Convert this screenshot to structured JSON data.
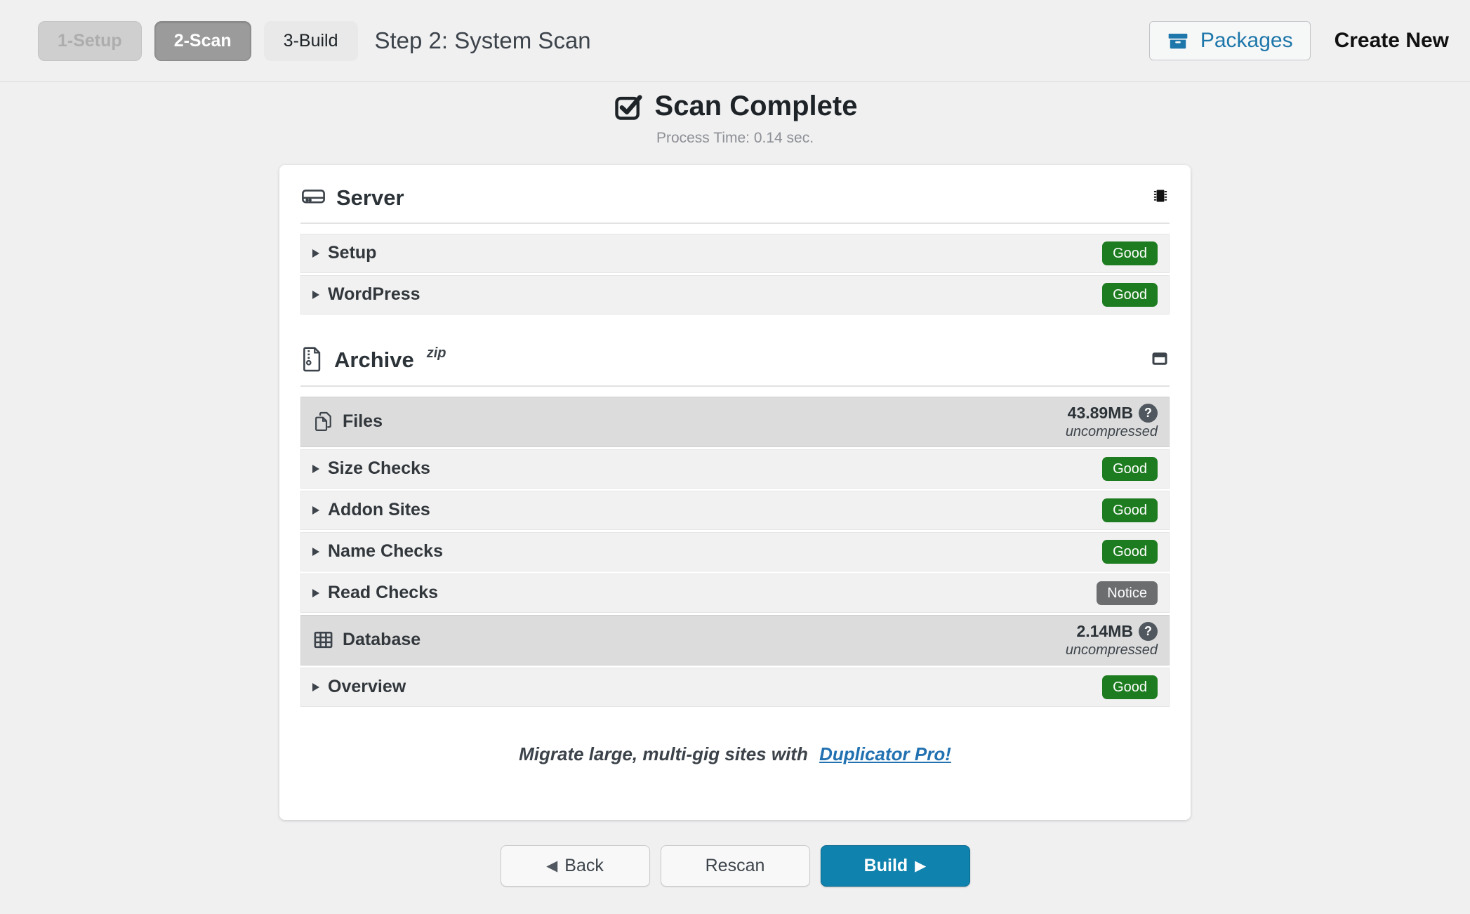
{
  "header": {
    "tabs": [
      {
        "label": "1-Setup",
        "state": "disabled"
      },
      {
        "label": "2-Scan",
        "state": "active"
      },
      {
        "label": "3-Build",
        "state": "upcoming"
      }
    ],
    "title": "Step 2: System Scan",
    "packages_label": "Packages",
    "create_new_label": "Create New"
  },
  "status": {
    "title": "Scan Complete",
    "process_time": "Process Time: 0.14 sec."
  },
  "server_section": {
    "title": "Server",
    "rows": [
      {
        "label": "Setup",
        "status": "Good"
      },
      {
        "label": "WordPress",
        "status": "Good"
      }
    ]
  },
  "archive_section": {
    "title": "Archive",
    "format": "zip",
    "files_group": {
      "label": "Files",
      "size": "43.89MB",
      "note": "uncompressed"
    },
    "files_rows": [
      {
        "label": "Size Checks",
        "status": "Good"
      },
      {
        "label": "Addon Sites",
        "status": "Good"
      },
      {
        "label": "Name Checks",
        "status": "Good"
      },
      {
        "label": "Read Checks",
        "status": "Notice"
      }
    ],
    "database_group": {
      "label": "Database",
      "size": "2.14MB",
      "note": "uncompressed"
    },
    "database_rows": [
      {
        "label": "Overview",
        "status": "Good"
      }
    ]
  },
  "promo": {
    "text": "Migrate large, multi-gig sites with",
    "link_label": "Duplicator Pro!"
  },
  "footer": {
    "back_label": "Back",
    "rescan_label": "Rescan",
    "build_label": "Build"
  },
  "icons": {
    "back_arrow": "◀",
    "build_arrow": "▶",
    "help_glyph": "?"
  },
  "colors": {
    "good_badge": "#1e7c20",
    "notice_badge": "#6b6d6f",
    "primary_button": "#0f82ad",
    "link_blue": "#2271b1",
    "packages_blue": "#1d77aa"
  }
}
